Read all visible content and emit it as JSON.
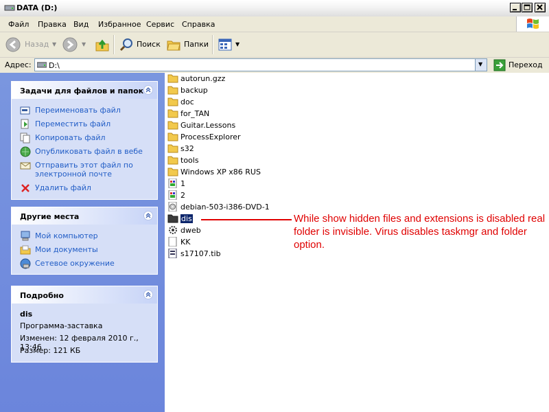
{
  "window": {
    "title": "DATA (D:)"
  },
  "menu": [
    "Файл",
    "Правка",
    "Вид",
    "Избранное",
    "Сервис",
    "Справка"
  ],
  "toolbar": {
    "back": "Назад",
    "search": "Поиск",
    "folders": "Папки"
  },
  "address": {
    "label": "Адрес:",
    "value": "D:\\",
    "go": "Переход"
  },
  "tasks_panel": {
    "title": "Задачи для файлов и папок",
    "items": [
      {
        "label": "Переименовать файл",
        "icon": "rename-icon"
      },
      {
        "label": "Переместить файл",
        "icon": "move-icon"
      },
      {
        "label": "Копировать файл",
        "icon": "copy-icon"
      },
      {
        "label": "Опубликовать файл в вебе",
        "icon": "publish-web-icon"
      },
      {
        "label": "Отправить этот файл по электронной почте",
        "icon": "email-icon"
      },
      {
        "label": "Удалить файл",
        "icon": "delete-icon"
      }
    ]
  },
  "places_panel": {
    "title": "Другие места",
    "items": [
      {
        "label": "Мой компьютер",
        "icon": "my-computer-icon"
      },
      {
        "label": "Мои документы",
        "icon": "my-documents-icon"
      },
      {
        "label": "Сетевое окружение",
        "icon": "network-icon"
      }
    ]
  },
  "details_panel": {
    "title": "Подробно",
    "name": "dis",
    "type": "Программа-заставка",
    "modified": "Изменен: 12 февраля 2010 г., 13:46",
    "size": "Размер: 121 КБ"
  },
  "files": [
    {
      "name": "autorun.gzz",
      "kind": "folder"
    },
    {
      "name": "backup",
      "kind": "folder"
    },
    {
      "name": "doc",
      "kind": "folder"
    },
    {
      "name": "for_TAN",
      "kind": "folder"
    },
    {
      "name": "Guitar.Lessons",
      "kind": "folder"
    },
    {
      "name": "ProcessExplorer",
      "kind": "folder"
    },
    {
      "name": "s32",
      "kind": "folder"
    },
    {
      "name": "tools",
      "kind": "folder"
    },
    {
      "name": "Windows XP x86 RUS",
      "kind": "folder"
    },
    {
      "name": "1",
      "kind": "image"
    },
    {
      "name": "2",
      "kind": "image"
    },
    {
      "name": "debian-503-i386-DVD-1",
      "kind": "disc"
    },
    {
      "name": "dis",
      "kind": "fake-folder",
      "selected": true
    },
    {
      "name": "dweb",
      "kind": "gear"
    },
    {
      "name": "KK",
      "kind": "file"
    },
    {
      "name": "s17107.tib",
      "kind": "tib"
    }
  ],
  "annotation": {
    "text": "While show hidden files and extensions is disabled real folder is invisible. Virus disables taskmgr and folder option.",
    "color": "#e00000"
  },
  "colors": {
    "taskpane": "#6b85dc",
    "link": "#215dc6",
    "selection": "#0a246a"
  }
}
